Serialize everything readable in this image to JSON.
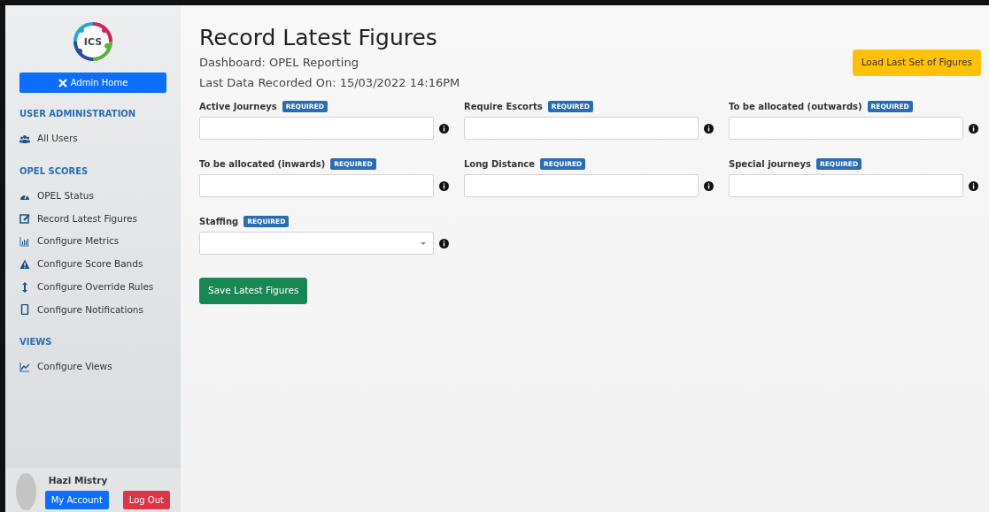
{
  "sidebar": {
    "logo_text": "ICS",
    "home_button": "Admin Home",
    "sections": [
      {
        "heading": "USER ADMINISTRATION",
        "items": [
          {
            "label": "All Users",
            "selected": false
          }
        ]
      },
      {
        "heading": "OPEL SCORES",
        "items": [
          {
            "label": "OPEL Status",
            "selected": false
          },
          {
            "label": "Record Latest Figures",
            "selected": false
          },
          {
            "label": "Configure Metrics",
            "selected": false
          },
          {
            "label": "Configure Score Bands",
            "selected": false
          },
          {
            "label": "Configure Override Rules",
            "selected": false
          },
          {
            "label": "Configure Notifications",
            "selected": false
          }
        ]
      },
      {
        "heading": "VIEWS",
        "items": [
          {
            "label": "Configure Views",
            "selected": false
          }
        ]
      }
    ],
    "user": {
      "name": "Hazi Mistry",
      "account_button": "My Account",
      "logout_button": "Log Out"
    }
  },
  "page": {
    "title": "Record Latest Figures",
    "subtitle": "Dashboard: OPEL Reporting",
    "last_recorded": "Last Data Recorded On: 15/03/2022 14:16PM",
    "load_button": "Load Last Set of Figures"
  },
  "fields": [
    {
      "label": "Active Journeys",
      "badge": "REQUIRED",
      "kind": "text"
    },
    {
      "label": "Require Escorts",
      "badge": "REQUIRED",
      "kind": "text"
    },
    {
      "label": "To be allocated (outwards)",
      "badge": "REQUIRED",
      "kind": "text"
    },
    {
      "label": "To be allocated (inwards)",
      "badge": "REQUIRED",
      "kind": "text"
    },
    {
      "label": "Long Distance",
      "badge": "REQUIRED",
      "kind": "text"
    },
    {
      "label": "Special journeys",
      "badge": "REQUIRED",
      "kind": "text"
    },
    {
      "label": "Staffing",
      "badge": "REQUIRED",
      "kind": "select"
    }
  ],
  "save_button": "Save Latest Figures"
}
